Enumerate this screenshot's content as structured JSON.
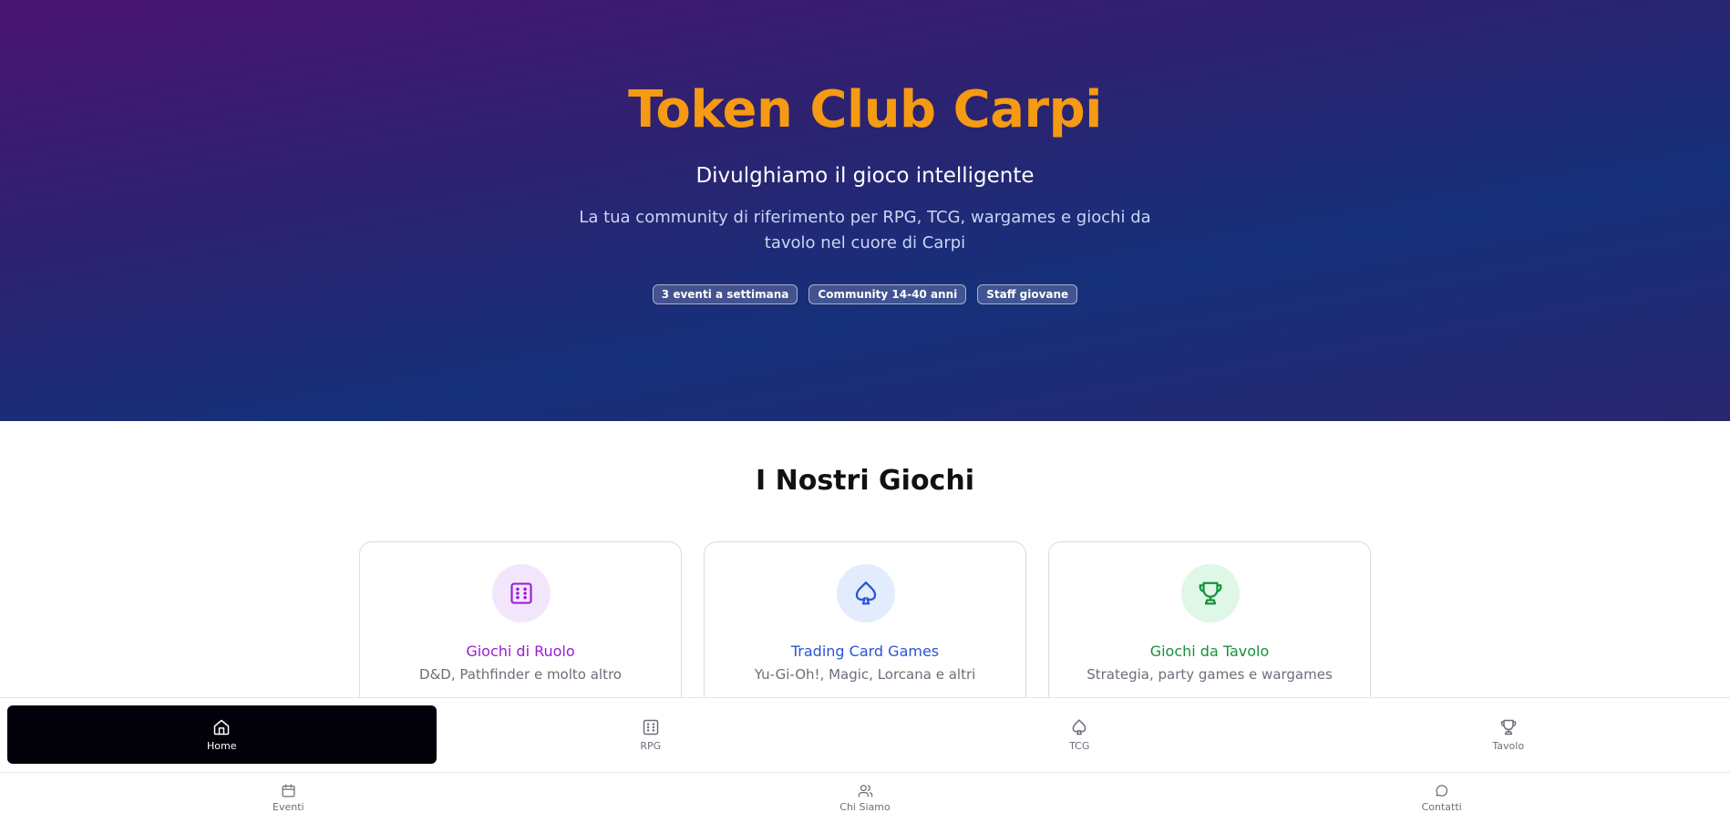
{
  "hero": {
    "title": "Token Club Carpi",
    "subtitle": "Divulghiamo il gioco intelligente",
    "description": "La tua community di riferimento per RPG, TCG, wargames e giochi da tavolo nel cuore di Carpi",
    "badges": [
      "3 eventi a settimana",
      "Community 14-40 anni",
      "Staff giovane"
    ]
  },
  "games_section": {
    "title": "I Nostri Giochi",
    "cards": [
      {
        "title": "Giochi di Ruolo",
        "text": "D&D, Pathfinder e molto altro",
        "icon": "dice-icon",
        "color": "#9a1bd4",
        "icon_bg": "#f1e6fb"
      },
      {
        "title": "Trading Card Games",
        "text": "Yu-Gi-Oh!, Magic, Lorcana e altri",
        "icon": "spade-icon",
        "color": "#2a54d6",
        "icon_bg": "#e2ecfc"
      },
      {
        "title": "Giochi da Tavolo",
        "text": "Strategia, party games e wargames",
        "icon": "trophy-icon",
        "color": "#15923a",
        "icon_bg": "#dff7e6"
      }
    ]
  },
  "bottom_nav": {
    "primary": [
      {
        "label": "Home",
        "icon": "home-icon",
        "active": true
      },
      {
        "label": "RPG",
        "icon": "dice-icon"
      },
      {
        "label": "TCG",
        "icon": "spade-icon"
      },
      {
        "label": "Tavolo",
        "icon": "trophy-icon"
      }
    ],
    "secondary": [
      {
        "label": "Eventi",
        "icon": "calendar-icon"
      },
      {
        "label": "Chi Siamo",
        "icon": "users-icon"
      },
      {
        "label": "Contatti",
        "icon": "chat-icon"
      }
    ]
  },
  "colors": {
    "title_orange": "#f59a12",
    "nav_active_bg": "#02010a"
  }
}
